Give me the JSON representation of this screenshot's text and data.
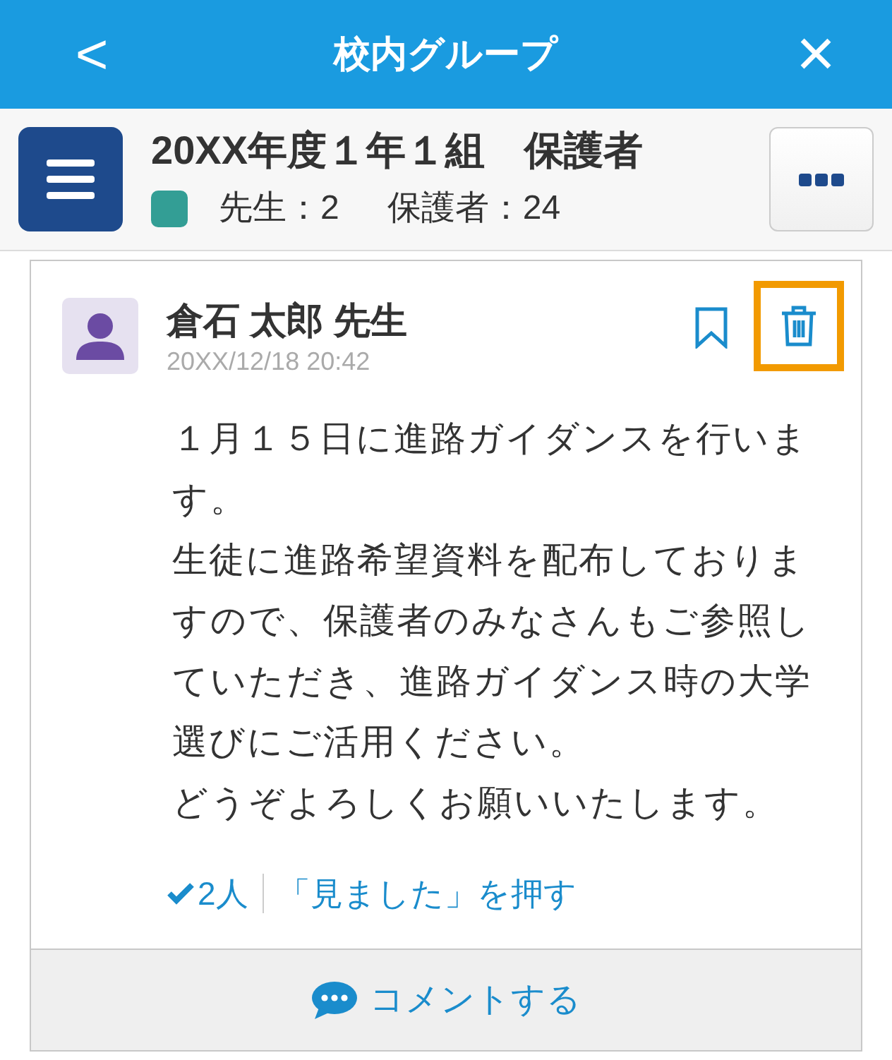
{
  "header": {
    "back": "<",
    "title": "校内グループ",
    "close": "×"
  },
  "group": {
    "name": "20XX年度１年１組　保護者",
    "color": "#339e95",
    "counts": [
      "先生：2",
      "保護者：24"
    ]
  },
  "post": {
    "author": "倉石 太郎 先生",
    "time": "20XX/12/18 20:42",
    "bookmarked": false,
    "delete_highlighted": true,
    "paragraphs": [
      "１月１５日に進路ガイダンスを行います。",
      "生徒に進路希望資料を配布しておりますので、保護者のみなさんもご参照していただき、進路ガイダンス時の大学選びにご活用ください。",
      "どうぞよろしくお願いいたします。"
    ],
    "seen_count": "2人",
    "seen_action": "「見ました」を押す",
    "comment": "コメントする"
  }
}
